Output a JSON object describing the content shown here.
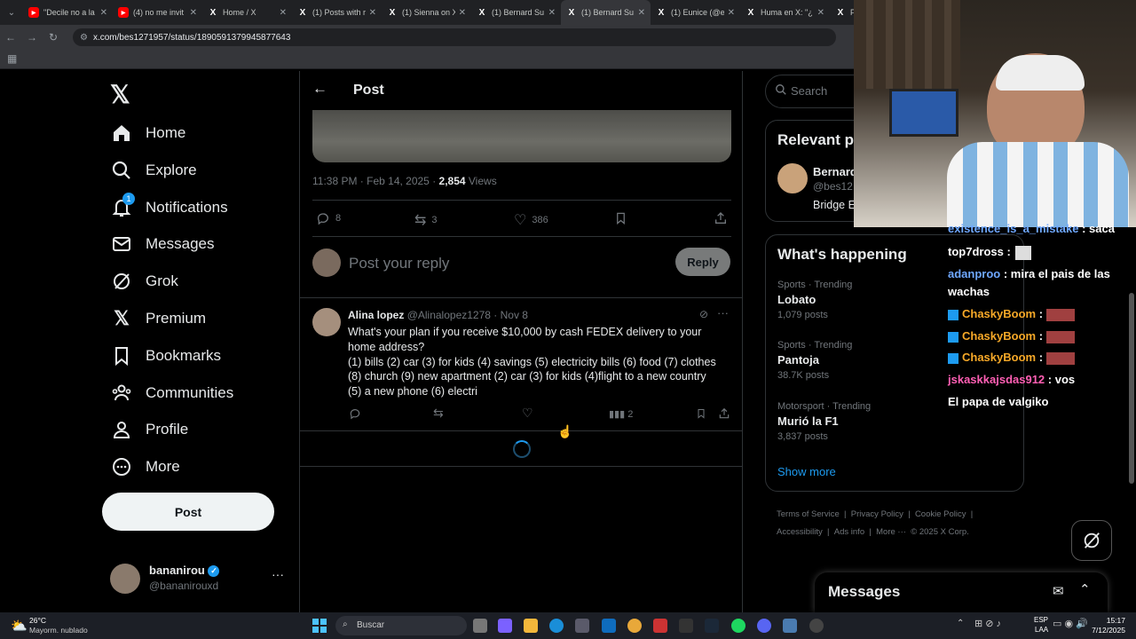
{
  "browser": {
    "tabs": [
      {
        "title": "\"Decile no a la",
        "icon": "youtube-icon"
      },
      {
        "title": "(4) no me invit",
        "icon": "youtube-icon"
      },
      {
        "title": "Home / X",
        "icon": "x-icon"
      },
      {
        "title": "(1) Posts with r",
        "icon": "x-icon"
      },
      {
        "title": "(1) Sienna on X",
        "icon": "x-icon"
      },
      {
        "title": "(1) Bernard Su",
        "icon": "x-icon"
      },
      {
        "title": "(1) Bernard Su",
        "icon": "x-icon",
        "active": true
      },
      {
        "title": "(1) Eunice (@e",
        "icon": "x-icon"
      },
      {
        "title": "Huma en X: \"¿",
        "icon": "x-icon"
      },
      {
        "title": "PC",
        "icon": "x-icon"
      }
    ],
    "url": "x.com/bes1271957/status/1890591379945877643"
  },
  "nav": {
    "items": [
      {
        "label": "Home",
        "icon": "home-icon"
      },
      {
        "label": "Explore",
        "icon": "search-icon"
      },
      {
        "label": "Notifications",
        "icon": "bell-icon",
        "badge": "1"
      },
      {
        "label": "Messages",
        "icon": "envelope-icon"
      },
      {
        "label": "Grok",
        "icon": "grok-icon"
      },
      {
        "label": "Premium",
        "icon": "x-icon"
      },
      {
        "label": "Bookmarks",
        "icon": "bookmark-icon"
      },
      {
        "label": "Communities",
        "icon": "people-icon"
      },
      {
        "label": "Profile",
        "icon": "person-icon"
      },
      {
        "label": "More",
        "icon": "more-circle-icon"
      }
    ],
    "post_button": "Post",
    "user": {
      "name": "bananirou",
      "handle": "@bananirouxd",
      "more": "···"
    }
  },
  "post": {
    "header": "Post",
    "time": "11:38 PM · Feb 14, 2025 · ",
    "views_count": "2,854",
    "views_label": " Views",
    "replies": "8",
    "reposts": "3",
    "likes": "386",
    "reply_placeholder": "Post your reply",
    "reply_button": "Reply"
  },
  "reply": {
    "name": "Alina lopez",
    "handle": "@Alinalopez1278 · Nov 8",
    "text_lines": [
      "What's your plan if you receive $10,000 by cash FEDEX delivery to your",
      "home address?",
      "(1) bills (2) car (3) for kids (4) savings (5) electricity bills (6) food (7) clothes",
      "(8) church (9) new apartment   (2) car (3) for kids (4)flight to a new country",
      "(5) a new  phone (6) electri"
    ],
    "views": "2"
  },
  "right": {
    "search_placeholder": "Search",
    "relevant_title": "Relevant p",
    "relevant_name": "Bernard",
    "relevant_handle": "@bes12",
    "relevant_bio": "Bridge E",
    "happening_title": "What's happening",
    "trends": [
      {
        "context": "Sports · Trending",
        "name": "Lobato",
        "posts": "1,079 posts"
      },
      {
        "context": "Sports · Trending",
        "name": "Pantoja",
        "posts": "38.7K posts"
      },
      {
        "context": "Motorsport · Trending",
        "name": "Murió la F1",
        "posts": "3,837 posts"
      }
    ],
    "show_more": "Show more",
    "footer": [
      "Terms of Service",
      "|",
      "Privacy Policy",
      "|",
      "Cookie Policy",
      "|",
      "Accessibility",
      "|",
      "Ads info",
      "|",
      "More ···",
      "© 2025 X Corp."
    ],
    "messages": "Messages"
  },
  "chat": {
    "lines": [
      {
        "user": "existence_is_a_mistake",
        "sep": " : ",
        "msg": "saca",
        "color": "#6fa8ff"
      },
      {
        "user": "top7dross",
        "sep": " : ",
        "msg": "",
        "color": "#ffffff"
      },
      {
        "user": "adanproo",
        "sep": " : ",
        "msg": "mira el pais de las",
        "color": "#6fa8ff"
      },
      {
        "user": "",
        "sep": "",
        "msg": "wachas",
        "color": "#ffffff"
      },
      {
        "user": "ChaskyBoom",
        "sep": " : ",
        "msg": "",
        "color": "#f7a928"
      },
      {
        "user": "ChaskyBoom",
        "sep": " : ",
        "msg": "",
        "color": "#f7a928"
      },
      {
        "user": "ChaskyBoom",
        "sep": " : ",
        "msg": "",
        "color": "#f7a928"
      },
      {
        "user": "jskaskkajsdas912",
        "sep": " : ",
        "msg": "vos",
        "color": "#ff5fb4"
      },
      {
        "user": "",
        "sep": "",
        "msg": "El papa de valgiko",
        "color": "#ffffff"
      }
    ]
  },
  "taskbar": {
    "weather_temp": "26°C",
    "weather_desc": "Mayorm. nublado",
    "search": "Buscar",
    "lang": "ESP",
    "lang2": "LAA",
    "time": "15:17",
    "date": "7/12/2025"
  },
  "colors": {
    "accent": "#1d9bf0",
    "border": "#2f3336",
    "muted": "#71767b"
  }
}
